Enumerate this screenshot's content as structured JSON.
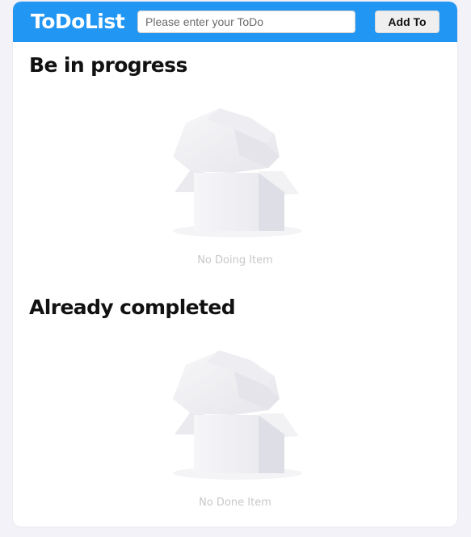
{
  "header": {
    "logo": "ToDoList",
    "input_placeholder": "Please enter your ToDo",
    "add_button_label": "Add To",
    "background_color": "#2196f3"
  },
  "sections": [
    {
      "title": "Be in progress",
      "empty_icon": "empty-box-icon",
      "empty_text": "No Doing Item"
    },
    {
      "title": "Already completed",
      "empty_icon": "empty-box-icon",
      "empty_text": "No Done Item"
    }
  ]
}
